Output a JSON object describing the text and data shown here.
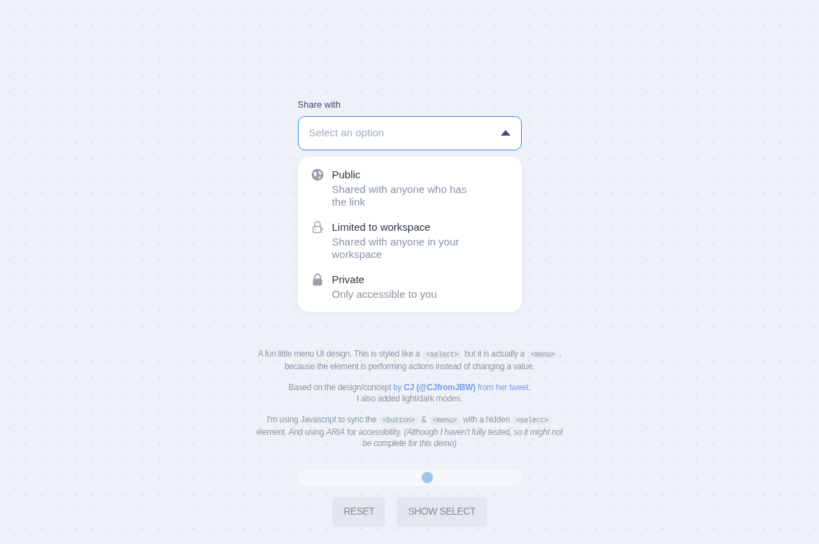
{
  "field": {
    "label": "Share with",
    "placeholder": "Select an option",
    "expanded": true
  },
  "menu": [
    {
      "kind": "globe",
      "title": "Public",
      "description": "Shared with anyone who has the link"
    },
    {
      "kind": "shared-lock",
      "title": "Limited to workspace",
      "description": "Shared with anyone in your workspace"
    },
    {
      "kind": "lock",
      "title": "Private",
      "description": "Only accessible to you"
    }
  ],
  "notes": [
    [
      {
        "kind": "text",
        "text": "A fun little menu UI design. This is styled like a"
      },
      {
        "kind": "code",
        "text": "<select>"
      },
      {
        "kind": "text",
        "text": "but it is actually a"
      },
      {
        "kind": "code",
        "text": "<menu>"
      },
      {
        "kind": "text",
        "text": ", because the element is performing actions instead of changing a value."
      }
    ],
    [
      {
        "kind": "text",
        "text": "Based on the design/concept"
      },
      {
        "kind": "link",
        "text": "by **CJ (@CJfromJBW)** from her tweet."
      },
      {
        "kind": "break"
      },
      {
        "kind": "text",
        "text": "I also added light/dark modes."
      }
    ],
    [
      {
        "kind": "text",
        "text": "I'm using Javascript to sync the"
      },
      {
        "kind": "code",
        "text": "<button>"
      },
      {
        "kind": "text",
        "text": "&"
      },
      {
        "kind": "code",
        "text": "<menu>"
      },
      {
        "kind": "text",
        "text": "with a hidden"
      },
      {
        "kind": "code",
        "text": "<select>"
      },
      {
        "kind": "text",
        "text": "element. And using"
      },
      {
        "kind": "italic",
        "text": "ARIA"
      },
      {
        "kind": "text",
        "text": "for accessibility."
      },
      {
        "kind": "italic",
        "text": "(Although I haven't fully tested, so it might not be complete for this demo)"
      }
    ]
  ],
  "slider": {
    "level": 0.58
  },
  "buttons": [
    "RESET",
    "SHOW SELECT"
  ]
}
